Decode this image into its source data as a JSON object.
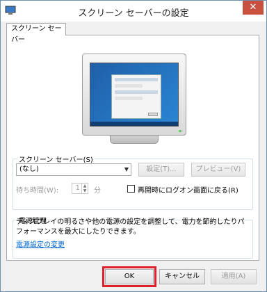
{
  "window": {
    "title": "スクリーン セーバーの設定",
    "close_glyph": "✕"
  },
  "tab": {
    "label": "スクリーン セーバー"
  },
  "screensaver": {
    "group_label": "スクリーン セーバー(S)",
    "selected": "(なし)",
    "settings_button": "設定(T)...",
    "preview_button": "プレビュー(V)",
    "wait_label": "待ち時間(W):",
    "wait_value": "1",
    "minutes_label": "分",
    "resume_logon_label": "再開時にログオン画面に戻る(R)",
    "resume_logon_checked": false
  },
  "power": {
    "group_label": "電源管理",
    "description": "ディスプレイの明るさや他の電源の設定を調整して、電力を節約したりパフォーマンスを最大にしたりできます。",
    "link": "電源設定の変更"
  },
  "buttons": {
    "ok": "OK",
    "cancel": "キャンセル",
    "apply": "適用(A)"
  },
  "colors": {
    "highlight": "#e0202a",
    "link": "#0066cc",
    "close": "#c7503f"
  }
}
